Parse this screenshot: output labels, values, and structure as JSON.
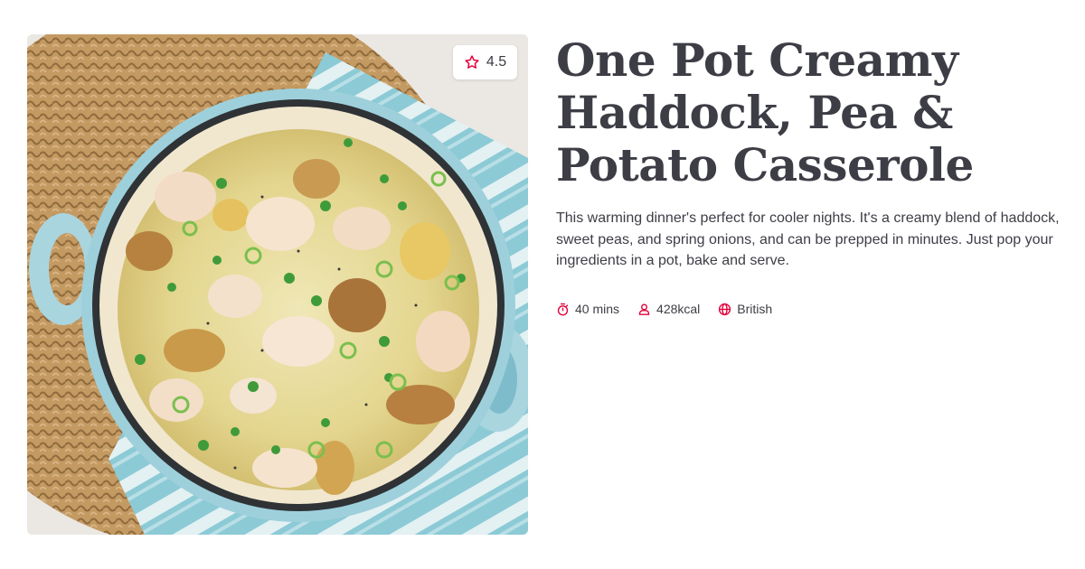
{
  "recipe": {
    "title": "One Pot Creamy Haddock, Pea & Potato Casserole",
    "description": "This warming dinner's perfect for cooler nights. It's a creamy blend of haddock, sweet peas, and spring onions, and can be prepped in minutes. Just pop your ingredients in a pot, bake and serve.",
    "rating": "4.5",
    "meta": {
      "time": "40 mins",
      "calories": "428kcal",
      "cuisine": "British"
    }
  },
  "icons": {
    "rating": "star-icon",
    "time": "stopwatch-icon",
    "calories": "person-icon",
    "cuisine": "globe-icon"
  },
  "colors": {
    "accent": "#e4003b",
    "text": "#3d3d46"
  }
}
